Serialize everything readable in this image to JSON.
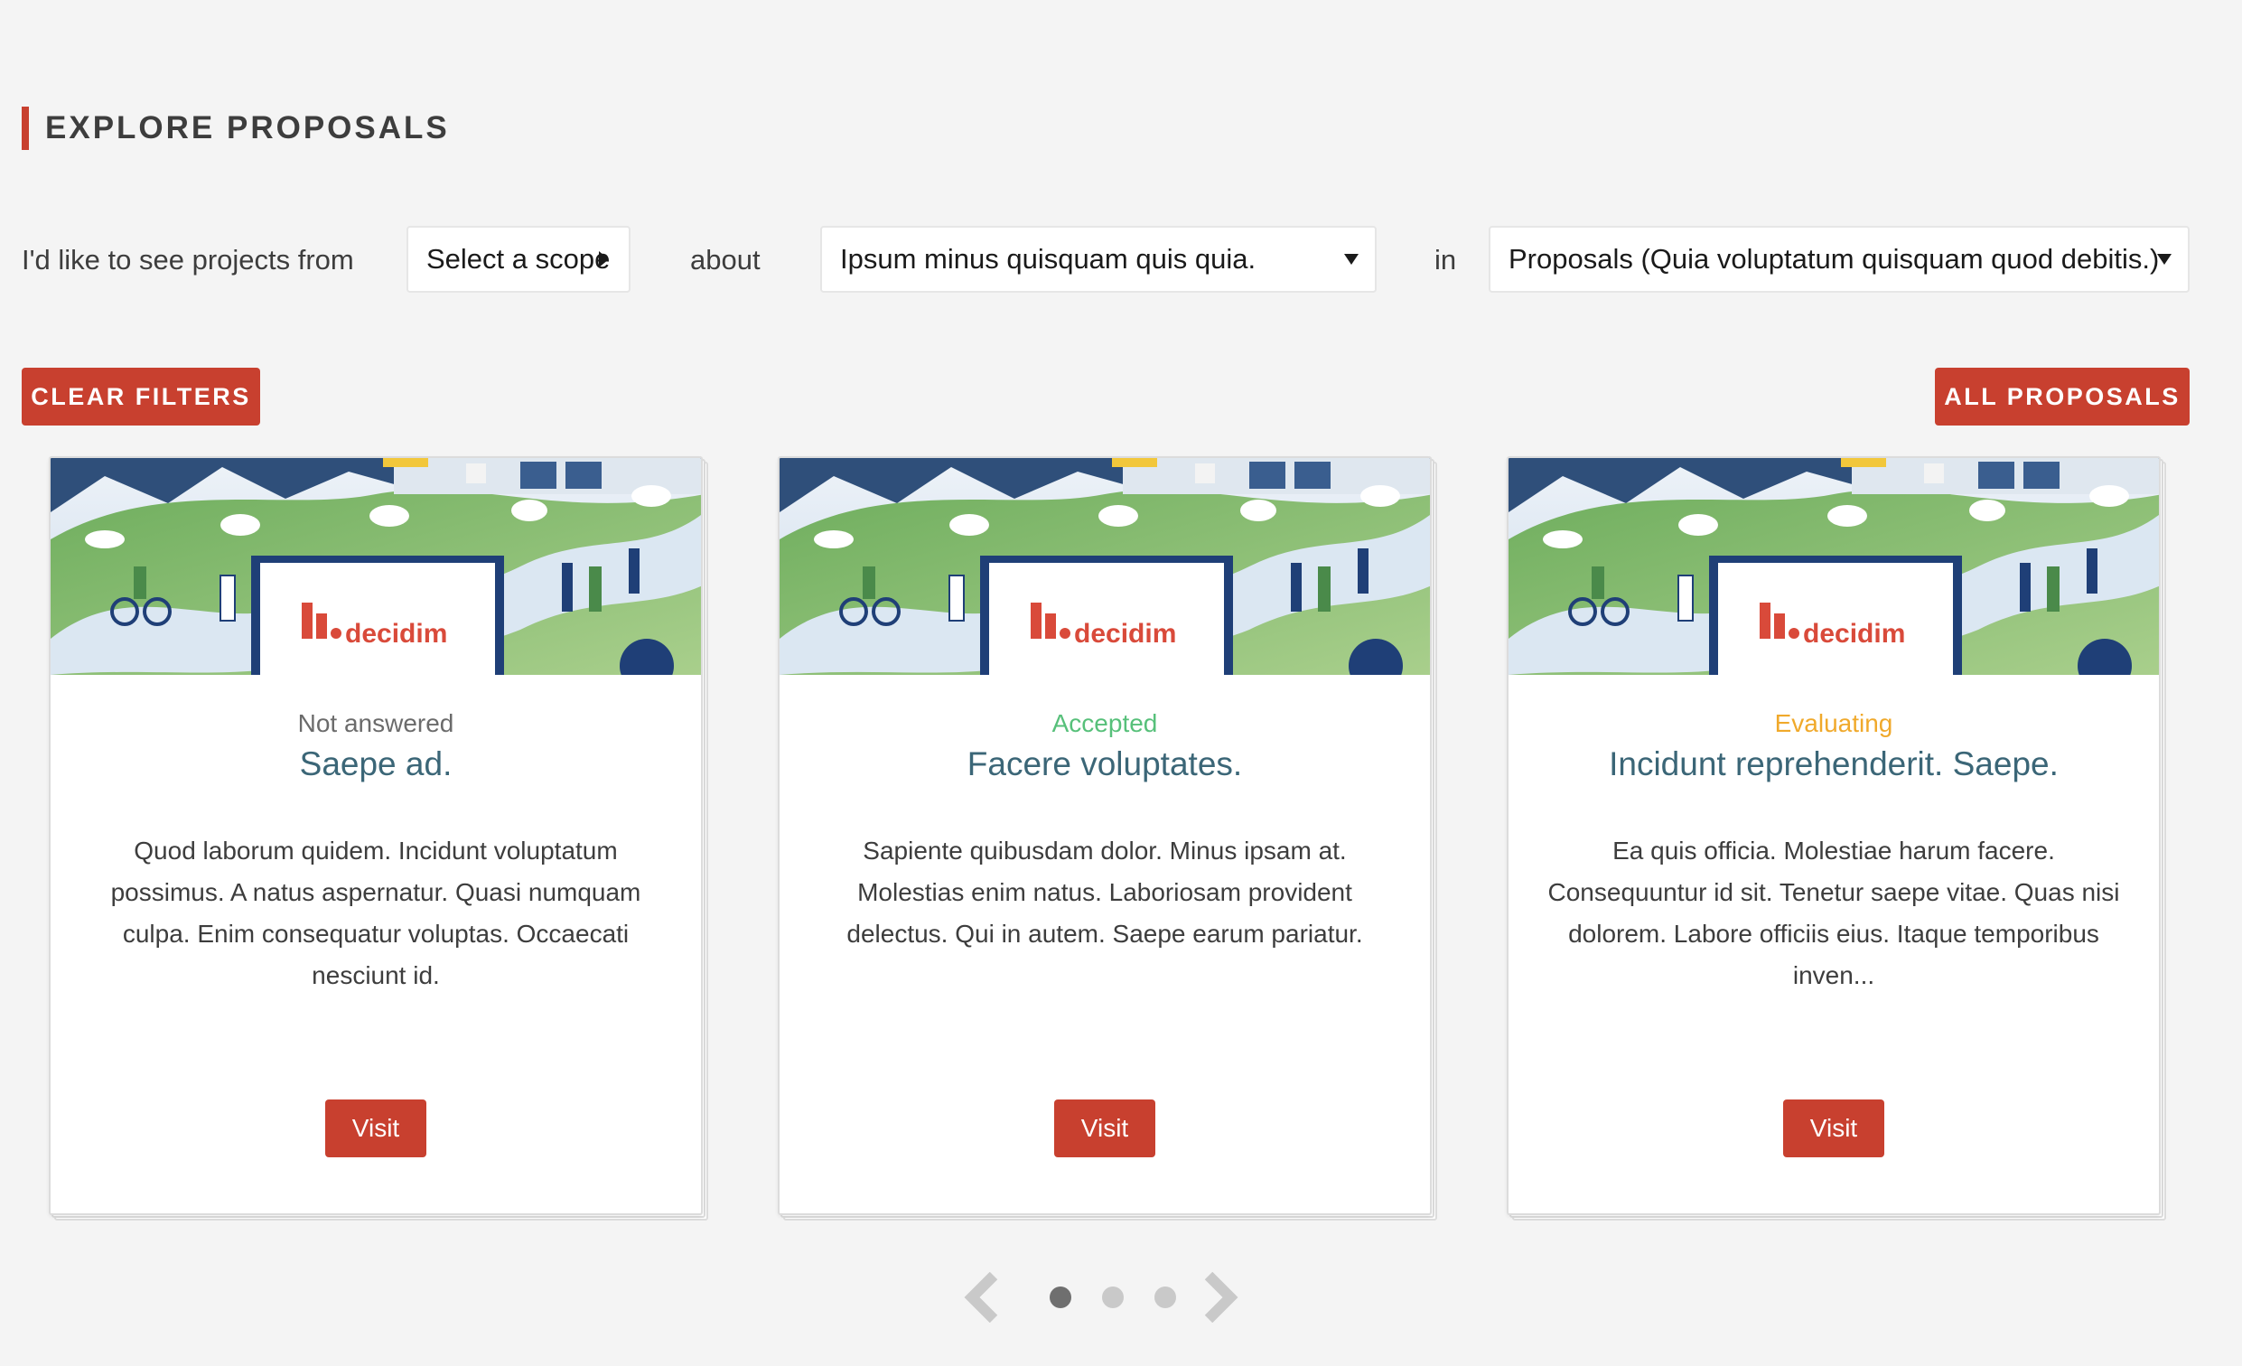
{
  "section": {
    "title": "EXPLORE PROPOSALS"
  },
  "filters": {
    "intro": "I'd like to see projects from",
    "scope_value": "Select a scope",
    "about_label": "about",
    "category_value": "Ipsum minus quisquam quis quia.",
    "in_label": "in",
    "component_value": "Proposals (Quia voluptatum quisquam quod debitis.)"
  },
  "buttons": {
    "clear_filters": "CLEAR FILTERS",
    "all_proposals": "ALL PROPOSALS"
  },
  "colors": {
    "accent": "#c8402f",
    "not_answered": "#6b6b6b",
    "accepted": "#57c07a",
    "evaluating": "#f0a92b",
    "title": "#3b6677"
  },
  "cards": [
    {
      "status": "Not answered",
      "status_color": "#6b6b6b",
      "title": "Saepe ad.",
      "body": "Quod laborum quidem. Incidunt voluptatum possimus. A natus aspernatur. Quasi numquam culpa. Enim consequatur voluptas. Occaecati nesciunt id.",
      "visit": "Visit",
      "image_logo": "decidim"
    },
    {
      "status": "Accepted",
      "status_color": "#57c07a",
      "title": "Facere voluptates.",
      "body": "Sapiente quibusdam dolor. Minus ipsam at. Molestias enim natus. Laboriosam provident delectus. Qui in autem. Saepe earum pariatur.",
      "visit": "Visit",
      "image_logo": "decidim"
    },
    {
      "status": "Evaluating",
      "status_color": "#f0a92b",
      "title": "Incidunt reprehenderit. Saepe.",
      "body": "Ea quis officia. Molestiae harum facere. Consequuntur id sit. Tenetur saepe vitae. Quas nisi dolorem. Labore officiis eius. Itaque temporibus inven...",
      "visit": "Visit",
      "image_logo": "decidim"
    }
  ],
  "pager": {
    "pages": 3,
    "active": 1
  },
  "icons": {
    "prev": "chevron-left-icon",
    "next": "chevron-right-icon"
  }
}
